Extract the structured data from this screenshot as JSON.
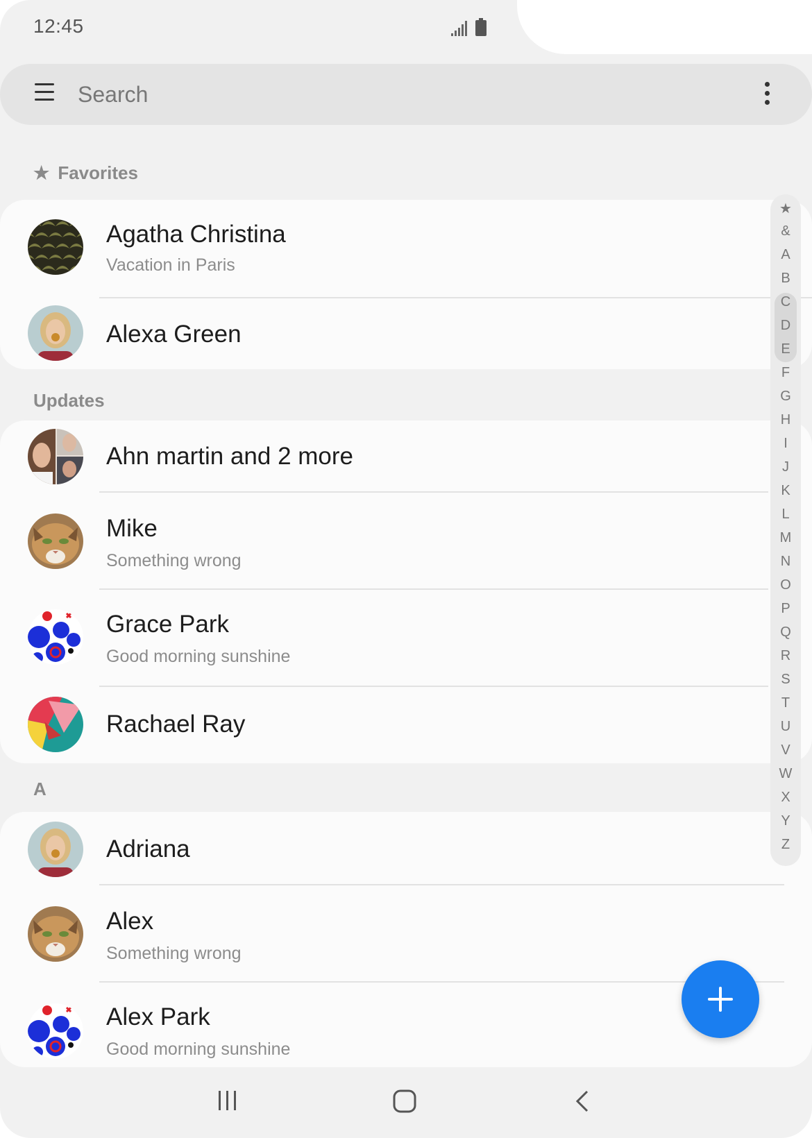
{
  "status_bar": {
    "time": "12:45"
  },
  "search": {
    "placeholder": "Search"
  },
  "sections": {
    "favorites": "Favorites",
    "updates": "Updates",
    "a": "A"
  },
  "favorites": [
    {
      "name": "Agatha Christina",
      "status": "Vacation in Paris",
      "avatar": "pattern-scales"
    },
    {
      "name": "Alexa Green",
      "status": "",
      "avatar": "photo-woman"
    }
  ],
  "updates": [
    {
      "name": "Ahn martin and 2 more",
      "status": "",
      "avatar": "group-photo"
    },
    {
      "name": "Mike",
      "status": "Something wrong",
      "avatar": "photo-cat"
    },
    {
      "name": "Grace Park",
      "status": "Good morning sunshine",
      "avatar": "pattern-blue-dots"
    },
    {
      "name": "Rachael Ray",
      "status": "",
      "avatar": "pattern-geometric"
    }
  ],
  "contacts_a": [
    {
      "name": "Adriana",
      "status": "",
      "avatar": "photo-woman"
    },
    {
      "name": "Alex",
      "status": "Something wrong",
      "avatar": "photo-cat"
    },
    {
      "name": "Alex Park",
      "status": "Good morning sunshine",
      "avatar": "pattern-blue-dots"
    }
  ],
  "index": [
    "★",
    "&",
    "A",
    "B",
    "C",
    "D",
    "E",
    "F",
    "G",
    "H",
    "I",
    "J",
    "K",
    "L",
    "M",
    "N",
    "O",
    "P",
    "Q",
    "R",
    "S",
    "T",
    "U",
    "V",
    "W",
    "X",
    "Y",
    "Z"
  ],
  "colors": {
    "accent": "#1a7ef0",
    "background": "#f1f1f1",
    "card": "#fbfbfb"
  }
}
